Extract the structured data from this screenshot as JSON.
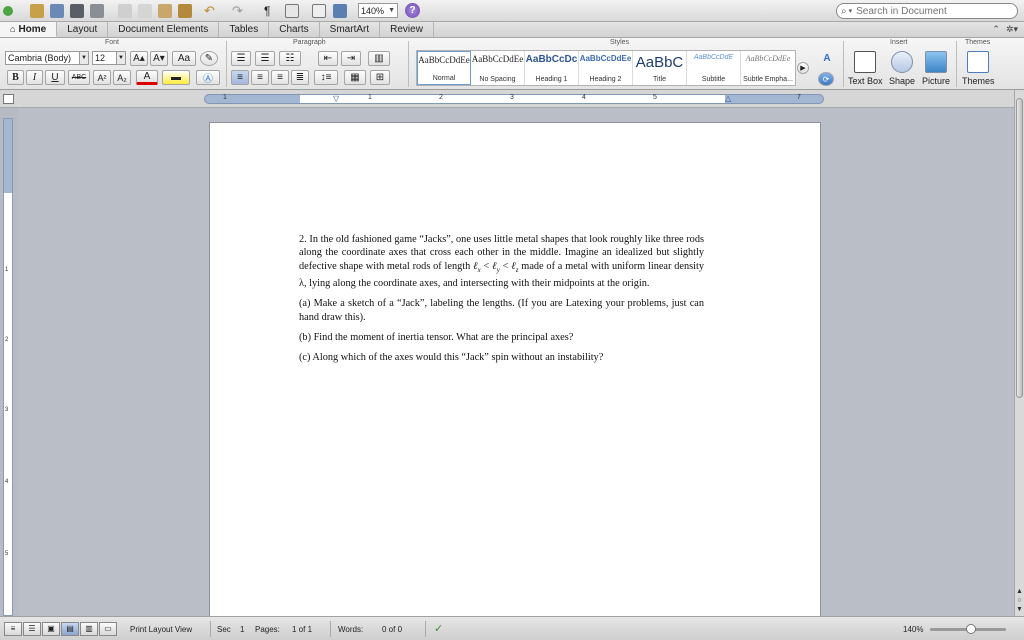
{
  "toolbar": {
    "zoom_value": "140%",
    "help_label": "?",
    "pilcrow": "¶"
  },
  "search": {
    "placeholder": "Search in Document"
  },
  "tabs": [
    {
      "label": "Home"
    },
    {
      "label": "Layout"
    },
    {
      "label": "Document Elements"
    },
    {
      "label": "Tables"
    },
    {
      "label": "Charts"
    },
    {
      "label": "SmartArt"
    },
    {
      "label": "Review"
    }
  ],
  "ribbon": {
    "groups": {
      "font": "Font",
      "paragraph": "Paragraph",
      "styles": "Styles",
      "insert": "Insert",
      "themes": "Themes"
    },
    "font_name": "Cambria (Body)",
    "font_size": "12",
    "font_buttons": {
      "bold": "B",
      "italic": "I",
      "underline": "U",
      "strike": "ABC",
      "superscript": "A²",
      "subscript": "A₂",
      "grow": "A▴",
      "shrink": "A▾",
      "case": "Aa",
      "color": "A"
    },
    "styles": [
      {
        "sample": "AaBbCcDdEe",
        "label": "Normal"
      },
      {
        "sample": "AaBbCcDdEe",
        "label": "No Spacing"
      },
      {
        "sample": "AaBbCcDc",
        "label": "Heading 1"
      },
      {
        "sample": "AaBbCcDdEe",
        "label": "Heading 2"
      },
      {
        "sample": "AaBbC",
        "label": "Title"
      },
      {
        "sample": "AaBbCcDdE",
        "label": "Subtitle"
      },
      {
        "sample": "AaBbCcDdEe",
        "label": "Subtle Empha..."
      }
    ],
    "insert": [
      {
        "label": "Text Box"
      },
      {
        "label": "Shape"
      },
      {
        "label": "Picture"
      }
    ],
    "themes_label": "Themes"
  },
  "ruler": {
    "numbers": [
      "1",
      "1",
      "2",
      "3",
      "4",
      "5",
      "6",
      "7"
    ]
  },
  "vruler": {
    "numbers": [
      "1",
      "2",
      "3",
      "4",
      "5"
    ]
  },
  "document": {
    "p1": "2. In the old fashioned game “Jacks”, one uses little metal shapes that look roughly like three rods along the coordinate axes that cross each other in the middle. Imagine an idealized but slightly defective shape with metal rods of length ℓ_x < ℓ_y < ℓ_z made of a metal with uniform linear density λ, lying along the coordinate axes, and intersecting with their midpoints at the origin.",
    "p1_parts": {
      "a": "2. In the old fashioned game “Jacks”, one uses little metal shapes that look roughly like three rods along the coordinate axes that cross each other in the middle. Imagine an idealized but slightly defective shape with metal rods of length ",
      "lx": "ℓ",
      "lx_sub": "x",
      "lt1": " < ",
      "ly": "ℓ",
      "ly_sub": "y",
      "lt2": " < ",
      "lz": "ℓ",
      "lz_sub": "z",
      "b": " made of a metal with uniform linear density λ, lying along the coordinate axes, and intersecting with their midpoints at the origin."
    },
    "pa": "(a) Make a sketch of a “Jack”, labeling the lengths. (If you are Latexing your problems, just can hand draw this).",
    "pb": "(b) Find the moment of inertia tensor. What are the principal axes?",
    "pc": "(c) Along which of the axes would this “Jack” spin without an instability?"
  },
  "status": {
    "view_name": "Print Layout View",
    "sec_label": "Sec",
    "sec_value": "1",
    "pages_label": "Pages:",
    "pages_value": "1 of 1",
    "words_label": "Words:",
    "words_value": "0 of 0",
    "zoom": "140%"
  },
  "colors": {
    "canvas": "#b9bec7",
    "ruler_blue": "#a3b7d3",
    "selected_tab": "#f5f5f5"
  }
}
